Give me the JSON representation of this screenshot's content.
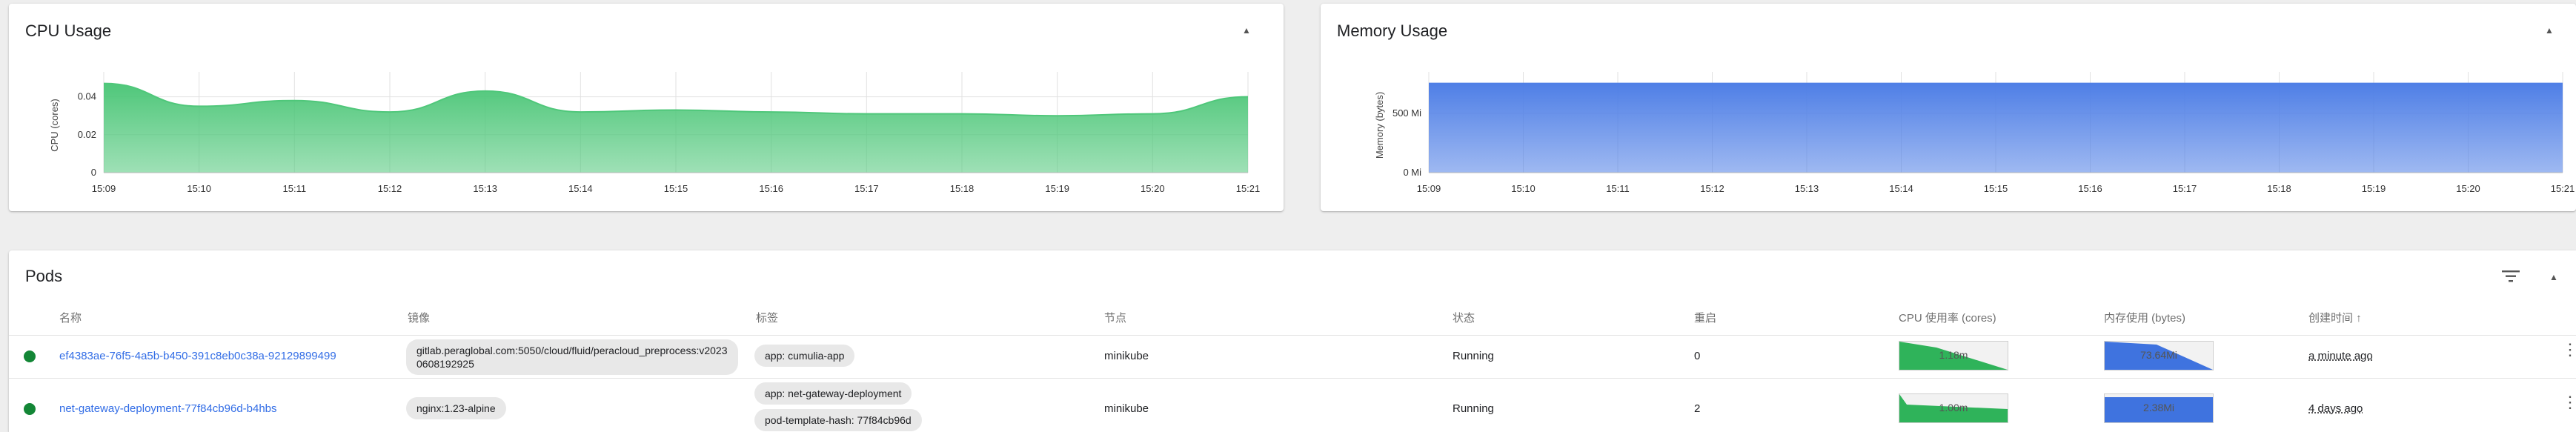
{
  "cpu_card": {
    "title": "CPU Usage",
    "collapse_icon": "chevron-up-icon",
    "chart_data": {
      "type": "area",
      "title": "",
      "xlabel": "",
      "ylabel": "CPU (cores)",
      "ylim": [
        0,
        0.05
      ],
      "y_ticks": [
        "0",
        "0.02",
        "0.04"
      ],
      "x": [
        "15:09",
        "15:10",
        "15:11",
        "15:12",
        "15:13",
        "15:14",
        "15:15",
        "15:16",
        "15:17",
        "15:18",
        "15:19",
        "15:20",
        "15:21"
      ],
      "values": [
        0.047,
        0.035,
        0.038,
        0.032,
        0.043,
        0.032,
        0.033,
        0.032,
        0.031,
        0.031,
        0.03,
        0.031,
        0.04
      ],
      "color": "#4fc77a",
      "grid": true
    }
  },
  "memory_card": {
    "title": "Memory Usage",
    "collapse_icon": "chevron-up-icon",
    "chart_data": {
      "type": "area",
      "title": "",
      "xlabel": "",
      "ylabel": "Memory (bytes)",
      "ylim": [
        0,
        800
      ],
      "y_ticks": [
        "0 Mi",
        "500 Mi"
      ],
      "y_tick_values": [
        0,
        500
      ],
      "x": [
        "15:09",
        "15:10",
        "15:11",
        "15:12",
        "15:13",
        "15:14",
        "15:15",
        "15:16",
        "15:17",
        "15:18",
        "15:19",
        "15:20",
        "15:21"
      ],
      "values": [
        752,
        752,
        752,
        752,
        752,
        752,
        752,
        752,
        752,
        752,
        752,
        752,
        752
      ],
      "color": "#4f7fe6",
      "grid": true
    }
  },
  "pods": {
    "title": "Pods",
    "filter_icon": "filter-icon",
    "collapse_icon": "chevron-up-icon",
    "columns": {
      "name": "名称",
      "image": "镜像",
      "labels": "标签",
      "node": "节点",
      "status": "状态",
      "restarts": "重启",
      "cpu": "CPU 使用率 (cores)",
      "memory": "内存使用 (bytes)",
      "created": "创建时间 ↑"
    },
    "rows": [
      {
        "name": "ef4383ae-76f5-4a5b-b450-391c8eb0c38a-92129899499",
        "image": "gitlab.peraglobal.com:5050/cloud/fluid/peracloud_preprocess:v20230608192925",
        "labels": [
          "app: cumulia-app"
        ],
        "node": "minikube",
        "status": "Running",
        "restarts": "0",
        "cpu": "1.18m",
        "memory": "73.64Mi",
        "created": "a minute ago",
        "status_color": "#138636"
      },
      {
        "name": "net-gateway-deployment-77f84cb96d-b4hbs",
        "image": "nginx:1.23-alpine",
        "labels": [
          "app: net-gateway-deployment",
          "pod-template-hash: 77f84cb96d"
        ],
        "node": "minikube",
        "status": "Running",
        "restarts": "2",
        "cpu": "1.00m",
        "memory": "2.38Mi",
        "created": "4 days ago",
        "status_color": "#138636"
      }
    ]
  }
}
